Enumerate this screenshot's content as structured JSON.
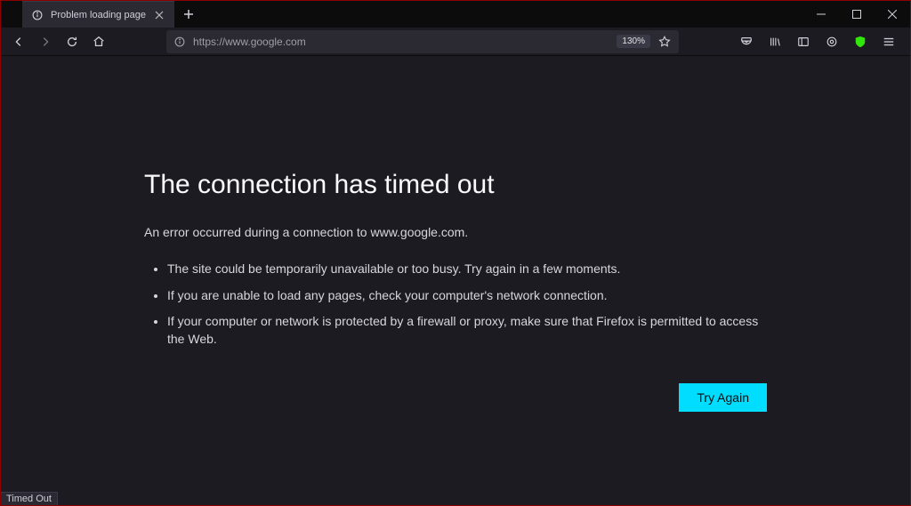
{
  "tab": {
    "title": "Problem loading page"
  },
  "urlbar": {
    "url": "https://www.google.com",
    "zoom": "130%"
  },
  "error": {
    "title": "The connection has timed out",
    "description": "An error occurred during a connection to www.google.com.",
    "bullets": [
      "The site could be temporarily unavailable or too busy. Try again in a few moments.",
      "If you are unable to load any pages, check your computer's network connection.",
      "If your computer or network is protected by a firewall or proxy, make sure that Firefox is permitted to access the Web."
    ],
    "retry_label": "Try Again"
  },
  "status": {
    "text": "Timed Out"
  }
}
